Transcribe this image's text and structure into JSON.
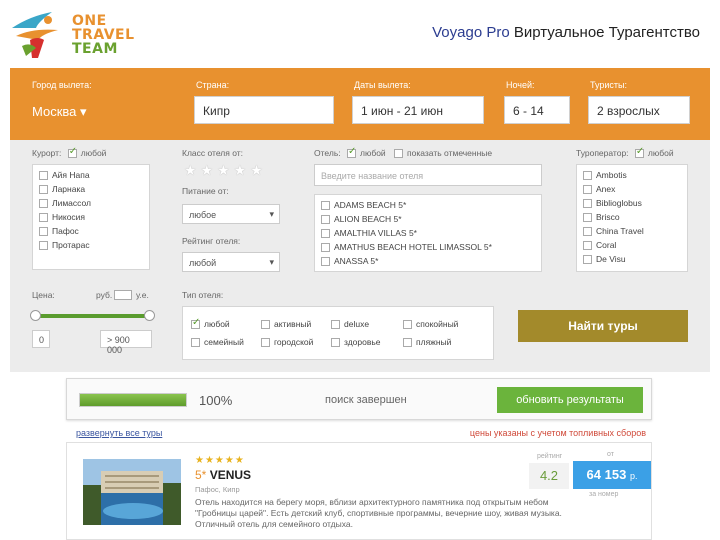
{
  "header": {
    "logo_line1": "ONE",
    "logo_line2": "TRAVEL",
    "logo_line3": "TEAM",
    "brand": "Voyago Pro",
    "title": "Виртуальное Турагентство"
  },
  "search": {
    "from_label": "Город вылета:",
    "from_value": "Москва ▾",
    "country_label": "Страна:",
    "country_value": "Кипр",
    "dates_label": "Даты вылета:",
    "dates_value": "1 июн - 21 июн",
    "nights_label": "Ночей:",
    "nights_value": "6 - 14",
    "tourists_label": "Туристы:",
    "tourists_value": "2 взрослых"
  },
  "filters": {
    "resort_label": "Курорт:",
    "resort_any": "любой",
    "resorts": [
      "Айя Напа",
      "Ларнака",
      "Лимассол",
      "Никосия",
      "Пафос",
      "Протарас"
    ],
    "class_label": "Класс отеля от:",
    "food_label": "Питание от:",
    "food_value": "любое",
    "rating_label": "Рейтинг отеля:",
    "rating_value": "любой",
    "hotel_label": "Отель:",
    "hotel_any": "любой",
    "hotel_show_marked": "показать отмеченные",
    "hotel_placeholder": "Введите название отеля",
    "hotels": [
      "ADAMS BEACH 5*",
      "ALION BEACH 5*",
      "AMALTHIA VILLAS 5*",
      "AMATHUS BEACH HOTEL LIMASSOL 5*",
      "ANASSA 5*"
    ],
    "operator_label": "Туроператор:",
    "operator_any": "любой",
    "operators": [
      "Ambotis",
      "Anex",
      "Biblioglobus",
      "Brisco",
      "China Travel",
      "Coral",
      "De Visu"
    ],
    "price_label": "Цена:",
    "currency_rub": "руб.",
    "currency_ue": "у.е.",
    "price_min": "0",
    "price_max": "> 900 000",
    "type_label": "Тип отеля:",
    "types": [
      "любой",
      "активный",
      "deluxe",
      "спокойный",
      "семейный",
      "городской",
      "здоровье",
      "пляжный"
    ],
    "find_button": "Найти туры"
  },
  "results": {
    "progress_percent": 100,
    "progress_text": "100%",
    "status_text": "поиск завершен",
    "refresh_button": "обновить результаты",
    "expand_link": "развернуть все туры",
    "price_note": "цены указаны с учетом топливных сборов",
    "hotel": {
      "stars": "★★★★★",
      "category": "5*",
      "name": "VENUS",
      "location": "Пафос, Кипр",
      "description": "Отель находится на берегу моря, вблизи архитектурного памятника под открытым небом \"Гробницы царей\". Есть детский клуб, спортивные программы, вечерние шоу, живая музыка. Отличный отель для семейного отдыха.",
      "rating_label": "рейтинг",
      "rating": "4.2",
      "price_label": "от",
      "price": "64 153",
      "price_currency": "р.",
      "price_sub": "за номер"
    }
  },
  "colors": {
    "orange": "#e8912f",
    "green": "#6bb43c",
    "find_button": "#a38a2b",
    "price": "#3ba0e6"
  }
}
